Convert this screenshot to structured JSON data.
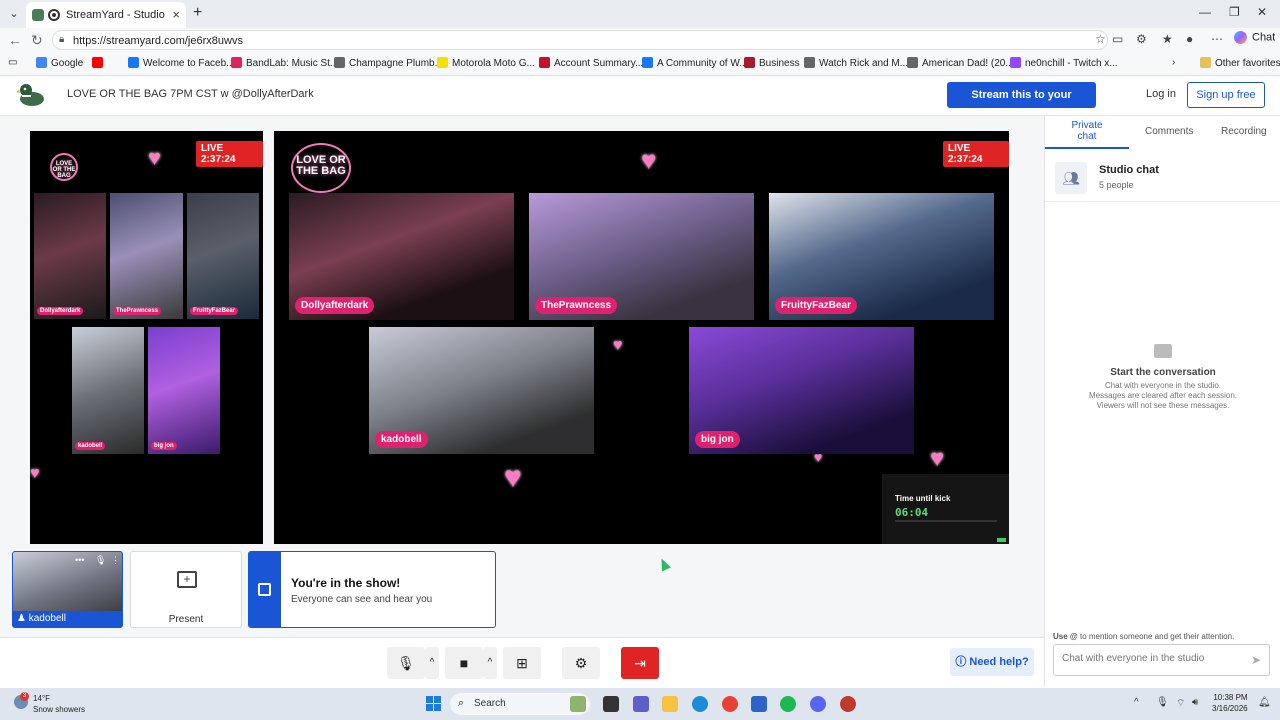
{
  "browser": {
    "tab_title": "StreamYard - Studio",
    "url": "https://streamyard.com/je6rx8uwvs",
    "chat_label": "Chat",
    "bookmarks": [
      {
        "label": "Google",
        "color": "#4285f4"
      },
      {
        "label": "",
        "color": "#ff0000"
      },
      {
        "label": "Welcome to Faceb...",
        "color": "#1877f2"
      },
      {
        "label": "BandLab: Music St...",
        "color": "#e0245e"
      },
      {
        "label": "Champagne Plumb...",
        "color": "#666666"
      },
      {
        "label": "Motorola Moto G...",
        "color": "#f5e000"
      },
      {
        "label": "Account Summary...",
        "color": "#c8102e"
      },
      {
        "label": "A Community of W...",
        "color": "#1877f2"
      },
      {
        "label": "Business",
        "color": "#a6192e"
      },
      {
        "label": "Watch Rick and M...",
        "color": "#666666"
      },
      {
        "label": "American Dad! (20...",
        "color": "#666666"
      },
      {
        "label": "ne0nchill - Twitch x...",
        "color": "#9146ff"
      }
    ],
    "other_favorites": "Other favorites"
  },
  "header": {
    "title": "LOVE OR THE BAG 7PM CST w @DollyAfterDark",
    "stream_button": "Stream this to your audience",
    "login": "Log in",
    "signup": "Sign up free"
  },
  "broadcast": {
    "live_label": "LIVE 2:37:24",
    "show_logo": "LOVE OR THE BAG",
    "participants": [
      "Dollyafterdark",
      "ThePrawncess",
      "FruittyFazBear",
      "kadobell",
      "big jon"
    ],
    "small_participants": [
      "Dollyafterdark",
      "ThePrawncess",
      "FruittyFazBear",
      "kadobell",
      "big jon"
    ],
    "kick_label": "Time until kick",
    "kick_timer": "06:04"
  },
  "tiles": {
    "self_name": "kadobell",
    "present_label": "Present",
    "inshow_title": "You're in the show!",
    "inshow_sub": "Everyone can see and hear you"
  },
  "controls": {
    "help": "Need help?"
  },
  "chat": {
    "tabs": [
      "Private chat",
      "Comments",
      "Recording"
    ],
    "room_title": "Studio chat",
    "room_sub": "5 people",
    "empty_title": "Start the conversation",
    "empty_lines": [
      "Chat with everyone in the studio.",
      "Messages are cleared after each session.",
      "Viewers will not see these messages."
    ],
    "hint_prefix": "Use",
    "hint_at": "@",
    "hint_rest": "to mention someone and get their attention.",
    "input_placeholder": "Chat with everyone in the studio"
  },
  "taskbar": {
    "weather_badge": "3",
    "temp": "14°F",
    "condition": "Snow showers",
    "search": "Search",
    "time": "10:38 PM",
    "date": "3/16/2026"
  },
  "colors": {
    "brand_blue": "#1a55d6",
    "live_red": "#e02424",
    "name_pink": "#e0226e",
    "timer_green": "#5ddc7a"
  }
}
